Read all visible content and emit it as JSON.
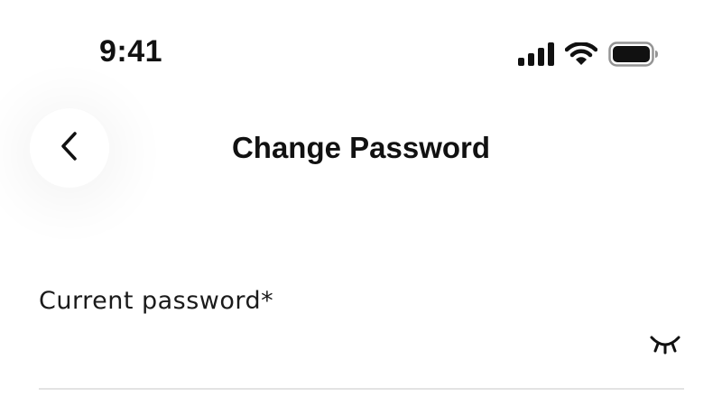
{
  "status_bar": {
    "time": "9:41",
    "icons": [
      "cellular-signal-icon",
      "wifi-icon",
      "battery-icon"
    ]
  },
  "header": {
    "back_icon": "chevron-left-icon",
    "title": "Change Password"
  },
  "form": {
    "current_password": {
      "label": "Current password*",
      "value": "",
      "placeholder": "",
      "toggle_icon": "eye-closed-icon"
    }
  },
  "colors": {
    "text": "#111111",
    "background": "#ffffff",
    "divider": "#e3e3e3"
  }
}
